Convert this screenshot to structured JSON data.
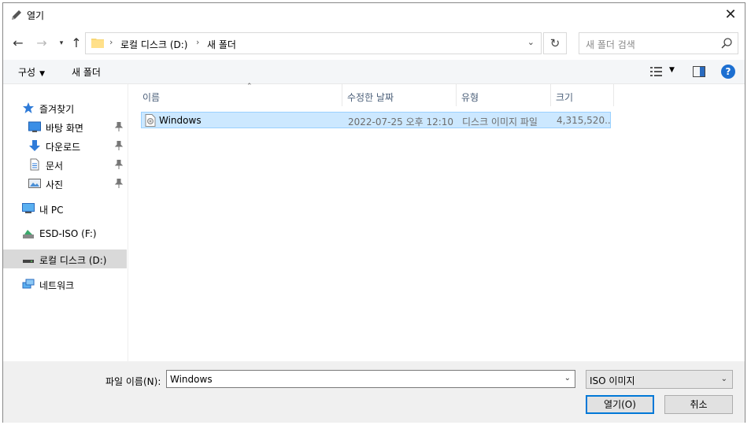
{
  "window": {
    "title": "열기",
    "close_icon": "close-icon"
  },
  "nav": {
    "back_icon": "arrow-left-icon",
    "forward_icon": "arrow-right-icon",
    "recent_icon": "chevron-down-icon",
    "up_icon": "arrow-up-icon",
    "breadcrumb": [
      "로컬 디스크 (D:)",
      "새 폴더"
    ],
    "search_placeholder": "새 폴더 검색"
  },
  "toolbar": {
    "organize_label": "구성",
    "new_folder_label": "새 폴더"
  },
  "sidebar": {
    "items": [
      {
        "label": "즐겨찾기",
        "icon": "star-icon",
        "pinned": false,
        "selected": false
      },
      {
        "label": "바탕 화면",
        "icon": "desktop-icon",
        "pinned": true,
        "selected": false
      },
      {
        "label": "다운로드",
        "icon": "download-icon",
        "pinned": true,
        "selected": false
      },
      {
        "label": "문서",
        "icon": "document-icon",
        "pinned": true,
        "selected": false
      },
      {
        "label": "사진",
        "icon": "pictures-icon",
        "pinned": true,
        "selected": false
      },
      {
        "label": "내 PC",
        "icon": "computer-icon",
        "pinned": false,
        "selected": false
      },
      {
        "label": "ESD-ISO (F:)",
        "icon": "usb-drive-icon",
        "pinned": false,
        "selected": false
      },
      {
        "label": "로컬 디스크 (D:)",
        "icon": "hard-drive-icon",
        "pinned": false,
        "selected": true
      },
      {
        "label": "네트워크",
        "icon": "network-icon",
        "pinned": false,
        "selected": false
      }
    ]
  },
  "columns": [
    "이름",
    "수정한 날짜",
    "유형",
    "크기"
  ],
  "files": [
    {
      "name": "Windows",
      "modified": "2022-07-25 오후 12:10",
      "type": "디스크 이미지 파일",
      "size": "4,315,520...",
      "icon": "disc-image-icon",
      "selected": true
    }
  ],
  "footer": {
    "filename_label": "파일 이름(N):",
    "filename_value": "Windows",
    "filetype_value": "ISO 이미지",
    "open_label": "열기(O)",
    "cancel_label": "취소"
  },
  "colors": {
    "accent": "#0078d7",
    "selection": "#cce8ff",
    "selection_border": "#99d1ff",
    "help": "#1c6fd1"
  }
}
